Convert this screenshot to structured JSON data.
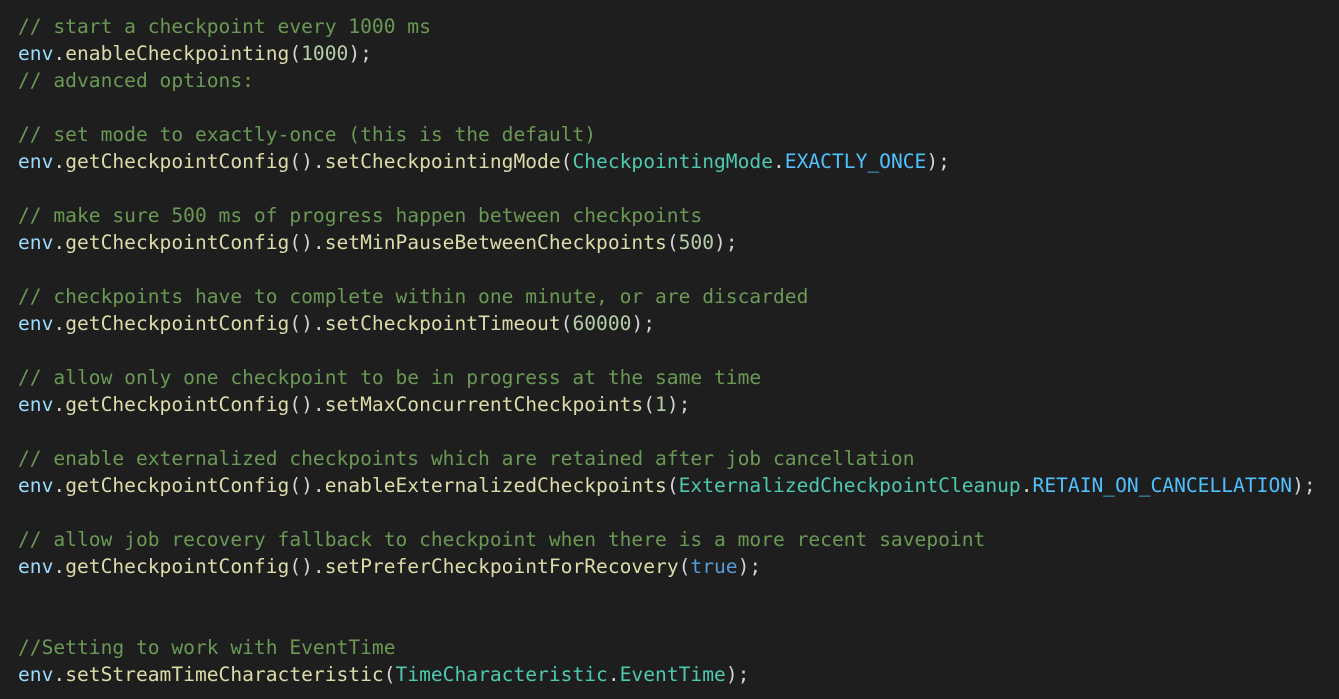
{
  "editor": {
    "theme_colors": {
      "background": "#1e1e1e",
      "comment": "#6a9955",
      "variable": "#9cdcfe",
      "function": "#dcdcaa",
      "number": "#b5cea8",
      "punctuation": "#d4d4d4",
      "type": "#4ec9b0",
      "constant": "#4fc1ff",
      "keyword": "#569cd6"
    },
    "lines": [
      [
        {
          "t": "comment",
          "v": "// start a checkpoint every 1000 ms"
        }
      ],
      [
        {
          "t": "var",
          "v": "env"
        },
        {
          "t": "punc",
          "v": "."
        },
        {
          "t": "func",
          "v": "enableCheckpointing"
        },
        {
          "t": "punc",
          "v": "("
        },
        {
          "t": "num",
          "v": "1000"
        },
        {
          "t": "punc",
          "v": ");"
        }
      ],
      [
        {
          "t": "comment",
          "v": "// advanced options:"
        }
      ],
      [],
      [
        {
          "t": "comment",
          "v": "// set mode to exactly-once (this is the default)"
        }
      ],
      [
        {
          "t": "var",
          "v": "env"
        },
        {
          "t": "punc",
          "v": "."
        },
        {
          "t": "func",
          "v": "getCheckpointConfig"
        },
        {
          "t": "punc",
          "v": "()."
        },
        {
          "t": "func",
          "v": "setCheckpointingMode"
        },
        {
          "t": "punc",
          "v": "("
        },
        {
          "t": "type",
          "v": "CheckpointingMode"
        },
        {
          "t": "punc",
          "v": "."
        },
        {
          "t": "const",
          "v": "EXACTLY_ONCE"
        },
        {
          "t": "punc",
          "v": ");"
        }
      ],
      [],
      [
        {
          "t": "comment",
          "v": "// make sure 500 ms of progress happen between checkpoints"
        }
      ],
      [
        {
          "t": "var",
          "v": "env"
        },
        {
          "t": "punc",
          "v": "."
        },
        {
          "t": "func",
          "v": "getCheckpointConfig"
        },
        {
          "t": "punc",
          "v": "()."
        },
        {
          "t": "func",
          "v": "setMinPauseBetweenCheckpoints"
        },
        {
          "t": "punc",
          "v": "("
        },
        {
          "t": "num",
          "v": "500"
        },
        {
          "t": "punc",
          "v": ");"
        }
      ],
      [],
      [
        {
          "t": "comment",
          "v": "// checkpoints have to complete within one minute, or are discarded"
        }
      ],
      [
        {
          "t": "var",
          "v": "env"
        },
        {
          "t": "punc",
          "v": "."
        },
        {
          "t": "func",
          "v": "getCheckpointConfig"
        },
        {
          "t": "punc",
          "v": "()."
        },
        {
          "t": "func",
          "v": "setCheckpointTimeout"
        },
        {
          "t": "punc",
          "v": "("
        },
        {
          "t": "num",
          "v": "60000"
        },
        {
          "t": "punc",
          "v": ");"
        }
      ],
      [],
      [
        {
          "t": "comment",
          "v": "// allow only one checkpoint to be in progress at the same time"
        }
      ],
      [
        {
          "t": "var",
          "v": "env"
        },
        {
          "t": "punc",
          "v": "."
        },
        {
          "t": "func",
          "v": "getCheckpointConfig"
        },
        {
          "t": "punc",
          "v": "()."
        },
        {
          "t": "func",
          "v": "setMaxConcurrentCheckpoints"
        },
        {
          "t": "punc",
          "v": "("
        },
        {
          "t": "num",
          "v": "1"
        },
        {
          "t": "punc",
          "v": ");"
        }
      ],
      [],
      [
        {
          "t": "comment",
          "v": "// enable externalized checkpoints which are retained after job cancellation"
        }
      ],
      [
        {
          "t": "var",
          "v": "env"
        },
        {
          "t": "punc",
          "v": "."
        },
        {
          "t": "func",
          "v": "getCheckpointConfig"
        },
        {
          "t": "punc",
          "v": "()."
        },
        {
          "t": "func",
          "v": "enableExternalizedCheckpoints"
        },
        {
          "t": "punc",
          "v": "("
        },
        {
          "t": "type",
          "v": "ExternalizedCheckpointCleanup"
        },
        {
          "t": "punc",
          "v": "."
        },
        {
          "t": "const",
          "v": "RETAIN_ON_CANCELLATION"
        },
        {
          "t": "punc",
          "v": ");"
        }
      ],
      [],
      [
        {
          "t": "comment",
          "v": "// allow job recovery fallback to checkpoint when there is a more recent savepoint"
        }
      ],
      [
        {
          "t": "var",
          "v": "env"
        },
        {
          "t": "punc",
          "v": "."
        },
        {
          "t": "func",
          "v": "getCheckpointConfig"
        },
        {
          "t": "punc",
          "v": "()."
        },
        {
          "t": "func",
          "v": "setPreferCheckpointForRecovery"
        },
        {
          "t": "punc",
          "v": "("
        },
        {
          "t": "kw",
          "v": "true"
        },
        {
          "t": "punc",
          "v": ");"
        }
      ],
      [],
      [],
      [
        {
          "t": "comment",
          "v": "//Setting to work with EventTime"
        }
      ],
      [
        {
          "t": "var",
          "v": "env"
        },
        {
          "t": "punc",
          "v": "."
        },
        {
          "t": "func",
          "v": "setStreamTimeCharacteristic"
        },
        {
          "t": "punc",
          "v": "("
        },
        {
          "t": "type",
          "v": "TimeCharacteristic"
        },
        {
          "t": "punc",
          "v": "."
        },
        {
          "t": "type",
          "v": "EventTime"
        },
        {
          "t": "punc",
          "v": ");"
        }
      ]
    ]
  }
}
